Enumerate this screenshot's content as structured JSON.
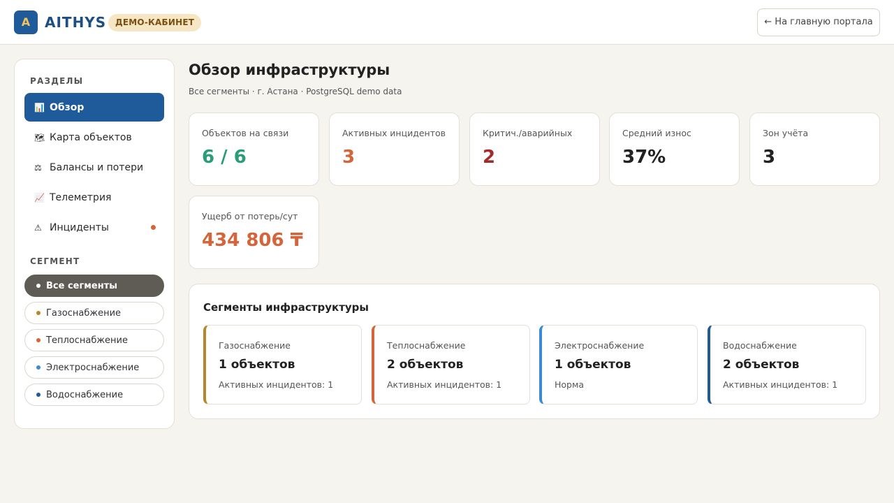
{
  "header": {
    "logo_letter": "A",
    "brand": "AITHYS",
    "badge": "ДЕМО-КАБИНЕТ",
    "portal_button": "← На главную портала"
  },
  "sidebar": {
    "sections_title": "РАЗДЕЛЫ",
    "nav": [
      {
        "label": "Обзор",
        "icon": "bar-chart-icon",
        "glyph": "📊",
        "active": true
      },
      {
        "label": "Карта объектов",
        "icon": "world-map-icon",
        "glyph": "🗺"
      },
      {
        "label": "Балансы и потери",
        "icon": "scales-icon",
        "glyph": "⚖"
      },
      {
        "label": "Телеметрия",
        "icon": "line-chart-icon",
        "glyph": "📈"
      },
      {
        "label": "Инциденты",
        "icon": "warning-icon",
        "glyph": "⚠",
        "has_alert": true
      }
    ],
    "segment_title": "СЕГМЕНТ",
    "segments": [
      {
        "label": "Все сегменты",
        "color": "#ffffff",
        "active": true
      },
      {
        "label": "Газоснабжение",
        "color": "#b8862a"
      },
      {
        "label": "Теплоснабжение",
        "color": "#d4653a"
      },
      {
        "label": "Электроснабжение",
        "color": "#3a8ad4"
      },
      {
        "label": "Водоснабжение",
        "color": "#1f5b9b"
      }
    ]
  },
  "main": {
    "title": "Обзор инфраструктуры",
    "subtitle": "Все сегменты · г. Астана · PostgreSQL demo data",
    "kpis": [
      {
        "label": "Объектов на связи",
        "value": "6 / 6",
        "color": "#2a9d77"
      },
      {
        "label": "Активных инцидентов",
        "value": "3",
        "color": "#d4653a"
      },
      {
        "label": "Критич./аварийных",
        "value": "2",
        "color": "#a52a2a"
      },
      {
        "label": "Средний износ",
        "value": "37%",
        "color": "#222222"
      },
      {
        "label": "Зон учёта",
        "value": "3",
        "color": "#222222"
      },
      {
        "label": "Ущерб от потерь/сут",
        "value": "434 806 ₸",
        "color": "#d4653a"
      }
    ],
    "segments_panel": {
      "title": "Сегменты инфраструктуры",
      "cards": [
        {
          "name": "Газоснабжение",
          "count": "1 объектов",
          "status": "Активных инцидентов: 1",
          "color": "#b8862a"
        },
        {
          "name": "Теплоснабжение",
          "count": "2 объектов",
          "status": "Активных инцидентов: 1",
          "color": "#d4653a"
        },
        {
          "name": "Электроснабжение",
          "count": "1 объектов",
          "status": "Норма",
          "color": "#3a8ad4"
        },
        {
          "name": "Водоснабжение",
          "count": "2 объектов",
          "status": "Активных инцидентов: 1",
          "color": "#1f5b9b"
        }
      ]
    }
  }
}
